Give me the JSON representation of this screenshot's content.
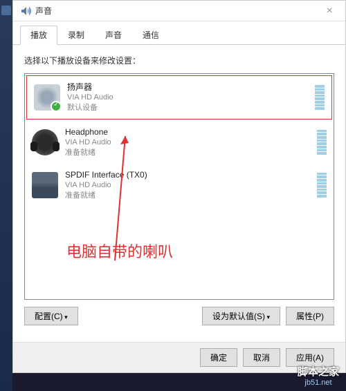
{
  "titlebar": {
    "title": "声音",
    "close_label": "×"
  },
  "tabs": [
    {
      "label": "播放",
      "active": true
    },
    {
      "label": "录制",
      "active": false
    },
    {
      "label": "声音",
      "active": false
    },
    {
      "label": "通信",
      "active": false
    }
  ],
  "prompt": "选择以下播放设备来修改设置：",
  "devices": [
    {
      "name": "扬声器",
      "driver": "VIA HD Audio",
      "status": "默认设备",
      "iconClass": "speaker-icon",
      "highlight": true,
      "default": true
    },
    {
      "name": "Headphone",
      "driver": "VIA HD Audio",
      "status": "准备就绪",
      "iconClass": "headset-icon",
      "highlight": false,
      "default": false
    },
    {
      "name": "SPDIF Interface (TX0)",
      "driver": "VIA HD Audio",
      "status": "准备就绪",
      "iconClass": "spdif-icon",
      "highlight": false,
      "default": false
    }
  ],
  "annotation": {
    "text": "电脑自带的喇叭",
    "color": "#e03030"
  },
  "buttons": {
    "configure": "配置(C)",
    "set_default": "设为默认值(S)",
    "properties": "属性(P)",
    "ok": "确定",
    "cancel": "取消",
    "apply": "应用(A)"
  },
  "watermark": {
    "cn": "脚本之家",
    "url": "jb51.net"
  }
}
